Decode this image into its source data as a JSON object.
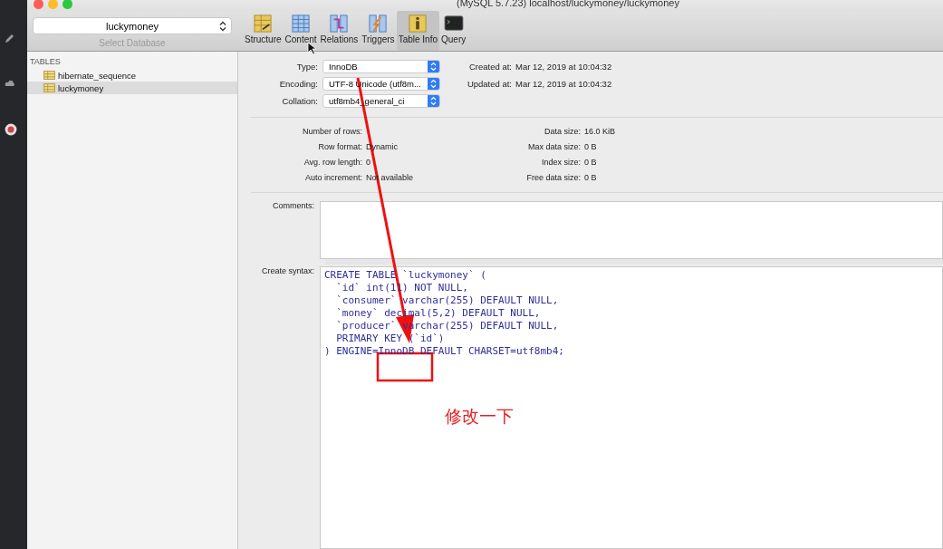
{
  "window": {
    "title": "(MySQL 5.7.23) localhost/luckymoney/luckymoney"
  },
  "database": {
    "value": "luckymoney",
    "caption": "Select Database"
  },
  "toolbar": [
    {
      "label": "Structure",
      "kind": "structure",
      "selected": false
    },
    {
      "label": "Content",
      "kind": "content",
      "selected": false
    },
    {
      "label": "Relations",
      "kind": "relations",
      "selected": false
    },
    {
      "label": "Triggers",
      "kind": "triggers",
      "selected": false
    },
    {
      "label": "Table Info",
      "kind": "info",
      "selected": true
    },
    {
      "label": "Query",
      "kind": "query",
      "selected": false
    }
  ],
  "sidebar": {
    "heading": "TABLES",
    "items": [
      {
        "label": "hibernate_sequence",
        "selected": false
      },
      {
        "label": "luckymoney",
        "selected": true
      }
    ]
  },
  "table_options": [
    {
      "label": "Type:",
      "value": "InnoDB"
    },
    {
      "label": "Encoding:",
      "value": "UTF-8 Unicode (utf8m..."
    },
    {
      "label": "Collation:",
      "value": "utf8mb4_general_ci"
    }
  ],
  "dates": [
    {
      "label": "Created at:",
      "value": "Mar 12, 2019 at 10:04:32"
    },
    {
      "label": "Updated at:",
      "value": "Mar 12, 2019 at 10:04:32"
    }
  ],
  "stats_left": [
    {
      "label": "Number of rows:"
    },
    {
      "label": "Row format:",
      "value": "Dynamic"
    },
    {
      "label": "Avg. row length:",
      "value": "0"
    },
    {
      "label": "Auto increment:",
      "value": "Not available"
    }
  ],
  "stats_right": [
    {
      "label": "Data size:",
      "value": "16.0 KiB"
    },
    {
      "label": "Max data size:",
      "value": "0 B"
    },
    {
      "label": "Index size:",
      "value": "0 B"
    },
    {
      "label": "Free data size:",
      "value": "0 B"
    }
  ],
  "comments": {
    "label": "Comments:"
  },
  "create_syntax": {
    "label": "Create syntax:",
    "lines": [
      "CREATE TABLE `luckymoney` (",
      "  `id` int(11) NOT NULL,",
      "  `consumer` varchar(255) DEFAULT NULL,",
      "  `money` decimal(5,2) DEFAULT NULL,",
      "  `producer` varchar(255) DEFAULT NULL,",
      "  PRIMARY KEY (`id`)",
      ") ENGINE=InnoDB DEFAULT CHARSET=utf8mb4;"
    ]
  },
  "annotation": {
    "text": "修改一下"
  }
}
